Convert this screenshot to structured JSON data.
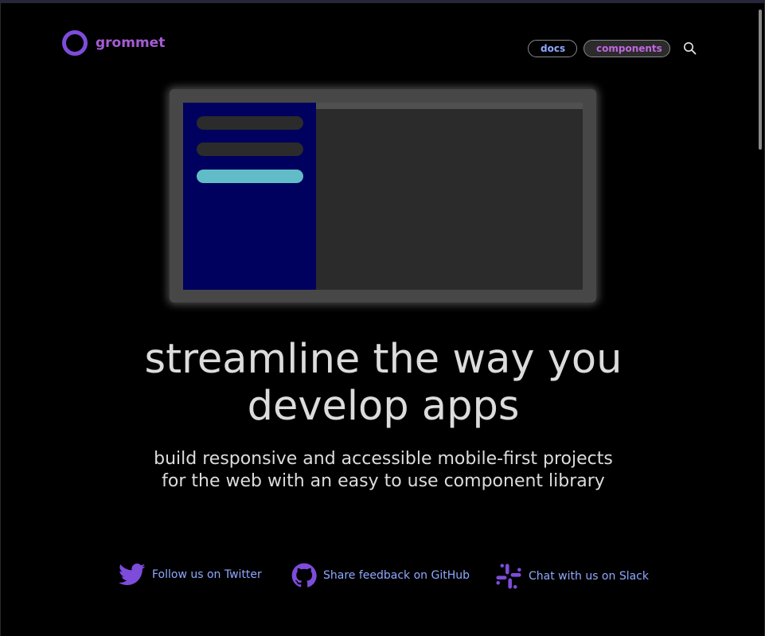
{
  "header": {
    "brand": "grommet",
    "nav": {
      "docs_label": "docs",
      "components_label": "components"
    },
    "search_icon": "search-icon"
  },
  "hero": {
    "headline_line1": "streamline the way you",
    "headline_line2": "develop apps",
    "subtitle_line1": "build responsive and accessible mobile-first projects",
    "subtitle_line2": "for the web with an easy to use component library"
  },
  "social": [
    {
      "icon": "twitter-icon",
      "label": "Follow us on Twitter"
    },
    {
      "icon": "github-icon",
      "label": "Share feedback on GitHub"
    },
    {
      "icon": "slack-icon",
      "label": "Chat with us on Slack"
    }
  ],
  "colors": {
    "brand": "#7d4cdb",
    "brand_text": "#a55cd4",
    "link": "#8fa8ff",
    "accent_teal": "#61bcc8",
    "sidebar_navy": "#00005e",
    "background": "#000000"
  }
}
